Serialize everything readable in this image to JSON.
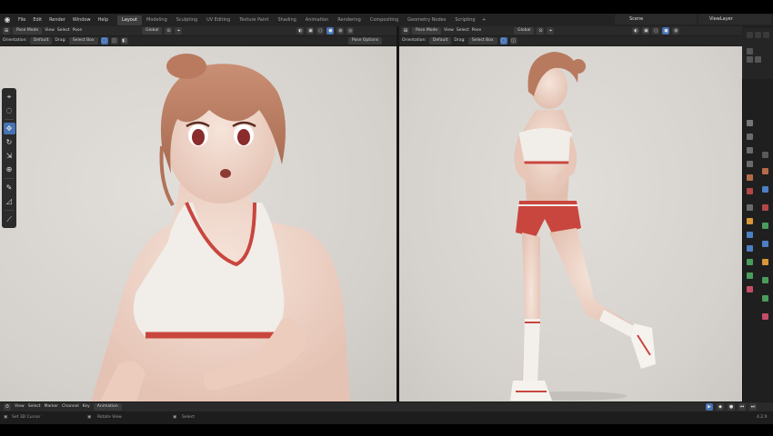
{
  "topbar": {
    "menus": [
      "File",
      "Edit",
      "Render",
      "Window",
      "Help"
    ],
    "workspaces": [
      "Layout",
      "Modeling",
      "Sculpting",
      "UV Editing",
      "Texture Paint",
      "Shading",
      "Animation",
      "Rendering",
      "Compositing",
      "Geometry Nodes",
      "Scripting"
    ],
    "active_workspace": "Layout",
    "add_tab": "+",
    "scene": "Scene",
    "view_layer": "ViewLayer"
  },
  "left_viewport": {
    "header": {
      "mode": "Pose Mode",
      "menus": [
        "View",
        "Select",
        "Pose"
      ],
      "transform": "Global"
    },
    "tool_settings": {
      "orientation_label": "Orientation:",
      "orientation": "Default",
      "drag_label": "Drag:",
      "drag": "Select Box"
    }
  },
  "right_viewport": {
    "header": {
      "mode": "Pose Mode",
      "menus": [
        "View",
        "Select",
        "Pose"
      ],
      "transform": "Global",
      "pose_options": "Pose Options"
    },
    "tool_settings": {
      "orientation_label": "Orientation:",
      "orientation": "Default",
      "drag_label": "Drag:",
      "drag": "Select Box"
    }
  },
  "timeline": {
    "menus": [
      "View",
      "Select",
      "Marker",
      "Channel",
      "Key"
    ],
    "mode": "Animation"
  },
  "statusbar": {
    "left": "Set 3D Cursor",
    "middle": "Rotate View",
    "right": "Select",
    "version": "4.2.0"
  },
  "colors": {
    "accent": "#4772b3",
    "panel": "#2a2a2a",
    "background": "#1d1d1d"
  }
}
